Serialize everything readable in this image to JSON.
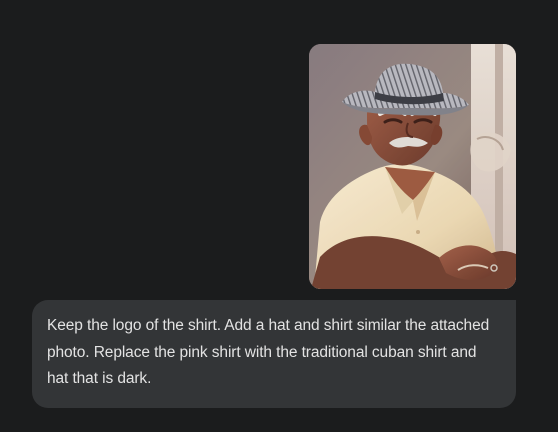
{
  "conversation": {
    "attachment": {
      "kind": "image",
      "subject": "photo"
    },
    "user_message": {
      "text": "Keep the logo of the shirt. Add a hat and shirt similar the attached photo. Replace the pink shirt with the traditional cuban shirt and hat that is dark."
    }
  },
  "colors": {
    "background": "#1b1c1d",
    "bubble": "#333537",
    "text": "#e3e3e3"
  }
}
